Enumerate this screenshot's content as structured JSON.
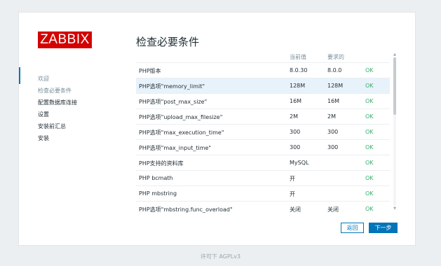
{
  "logo": "ZABBIX",
  "page_title": "检查必要条件",
  "steps": [
    {
      "label": "欢迎"
    },
    {
      "label": "检查必要条件"
    },
    {
      "label": "配置数据库连接"
    },
    {
      "label": "设置"
    },
    {
      "label": "安装前汇总"
    },
    {
      "label": "安装"
    }
  ],
  "table": {
    "headers": [
      "",
      "当前值",
      "要求的",
      ""
    ],
    "rows": [
      {
        "name": "PHP版本",
        "current": "8.0.30",
        "required": "8.0.0",
        "status": "OK"
      },
      {
        "name": "PHP选项\"memory_limit\"",
        "current": "128M",
        "required": "128M",
        "status": "OK"
      },
      {
        "name": "PHP选项\"post_max_size\"",
        "current": "16M",
        "required": "16M",
        "status": "OK"
      },
      {
        "name": "PHP选项\"upload_max_filesize\"",
        "current": "2M",
        "required": "2M",
        "status": "OK"
      },
      {
        "name": "PHP选项\"max_execution_time\"",
        "current": "300",
        "required": "300",
        "status": "OK"
      },
      {
        "name": "PHP选项\"max_input_time\"",
        "current": "300",
        "required": "300",
        "status": "OK"
      },
      {
        "name": "PHP支持的资料库",
        "current": "MySQL",
        "required": "",
        "status": "OK"
      },
      {
        "name": "PHP bcmath",
        "current": "开",
        "required": "",
        "status": "OK"
      },
      {
        "name": "PHP mbstring",
        "current": "开",
        "required": "",
        "status": "OK"
      },
      {
        "name": "PHP选项\"mbstring.func_overload\"",
        "current": "关闭",
        "required": "关闭",
        "status": "OK"
      }
    ]
  },
  "buttons": {
    "back": "返回",
    "next": "下一步"
  },
  "footer": "许可下 AGPLv3",
  "colors": {
    "brand": "#d40000",
    "accent": "#0275b8",
    "ok": "#34af67",
    "highlight": "#e8f2fb"
  }
}
